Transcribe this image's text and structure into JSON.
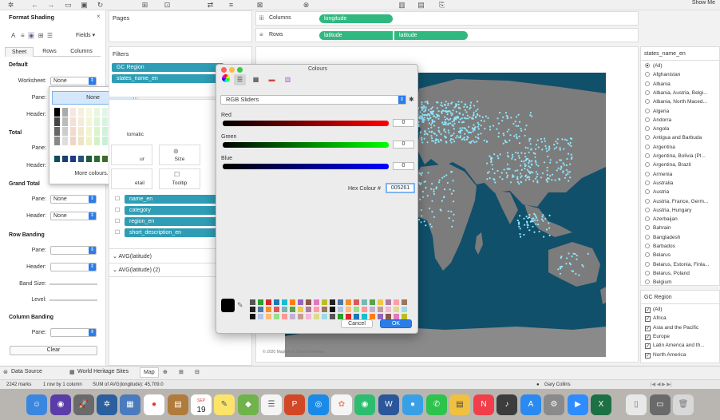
{
  "toolbar": {
    "show_me": "Show Me"
  },
  "format_pane": {
    "title": "Format Shading",
    "fields_label": "Fields",
    "tabs": [
      "Sheet",
      "Rows",
      "Columns"
    ],
    "default_section": "Default",
    "worksheet_label": "Worksheet:",
    "worksheet_value": "None",
    "pane_label": "Pane:",
    "header_label": "Header:",
    "total_section": "Total",
    "grand_total_section": "Grand Total",
    "grand_pane_value": "None",
    "grand_header_value": "None",
    "row_banding_section": "Row Banding",
    "band_size_label": "Band Size:",
    "level_label": "Level:",
    "column_banding_section": "Column Banding",
    "clear_button": "Clear"
  },
  "palette_popup": {
    "none_label": "None",
    "more_colours": "More colours..."
  },
  "pages_pane": {
    "title": "Pages"
  },
  "filters_pane": {
    "title": "Filters",
    "items": [
      "GC Region",
      "states_name_en"
    ]
  },
  "marks_pane": {
    "mark_type_partial": "tomatic",
    "size": "Size",
    "colour_partial": "ur",
    "tooltip": "Tooltip",
    "detail_partial": "etail",
    "fields": [
      "name_en",
      "category",
      "region_en",
      "short_description_en"
    ],
    "avg_rows": [
      "AVG(latitude)",
      "AVG(latitude) (2)"
    ]
  },
  "shelves": {
    "columns_label": "Columns",
    "columns_pills": [
      "longitude"
    ],
    "rows_label": "Rows",
    "rows_pills": [
      "latitude",
      "latitude"
    ]
  },
  "map": {
    "credit": "© 2020 Mapbox © OpenStreetMap",
    "background": "#10506a",
    "land": "#7c7c7c"
  },
  "states_filter": {
    "title": "states_name_en",
    "items": [
      "(All)",
      "Afghanistan",
      "Albania",
      "Albania, Austria, Belgi...",
      "Albania, North Maced...",
      "Algeria",
      "Andorra",
      "Angola",
      "Antigua and Barbuda",
      "Argentina",
      "Argentina, Bolivia (Pl...",
      "Argentina, Brazil",
      "Armenia",
      "Australia",
      "Austria",
      "Austria, France, Germ...",
      "Austria, Hungary",
      "Azerbaijan",
      "Bahrain",
      "Bangladesh",
      "Barbados",
      "Belarus",
      "Belarus, Estonia, Finla...",
      "Belarus, Poland",
      "Belgium"
    ]
  },
  "gc_filter": {
    "title": "GC Region",
    "items": [
      "(All)",
      "Africa",
      "Asia and the Pacific",
      "Europe",
      "Latin America and th...",
      "North America"
    ]
  },
  "colours_dialog": {
    "title": "Colours",
    "mode": "RGB Sliders",
    "red_label": "Red",
    "green_label": "Green",
    "blue_label": "Blue",
    "red_value": "0",
    "green_value": "0",
    "blue_value": "0",
    "hex_label": "Hex Colour #",
    "hex_value": "005261",
    "cancel": "Cancel",
    "ok": "OK"
  },
  "sheet_tabs": [
    "Data Source",
    "World Heritage Sites",
    "Map"
  ],
  "user": "Gary Collins",
  "status": {
    "marks": "2242 marks",
    "dims": "1 row by 1 column",
    "sum": "SUM of AVG(longitude): 45,709.0"
  },
  "dock": {
    "calendar_day": "19",
    "calendar_month": "SEP"
  }
}
